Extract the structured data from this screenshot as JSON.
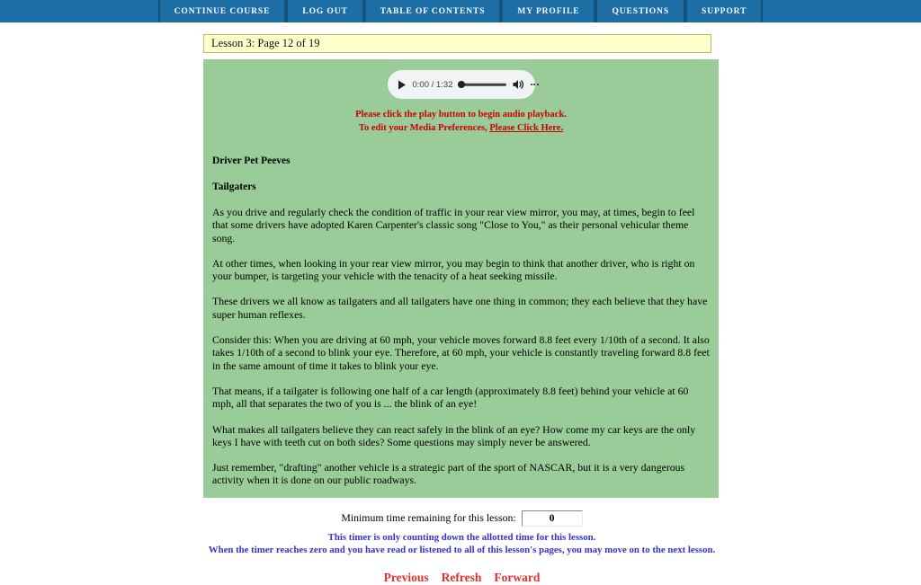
{
  "navbar": {
    "items": [
      {
        "label": "CONTINUE COURSE",
        "name": "nav-continue-course"
      },
      {
        "label": "LOG OUT",
        "name": "nav-log-out"
      },
      {
        "label": "TABLE OF CONTENTS",
        "name": "nav-table-of-contents"
      },
      {
        "label": "MY PROFILE",
        "name": "nav-my-profile"
      },
      {
        "label": "QUESTIONS",
        "name": "nav-questions"
      },
      {
        "label": "SUPPORT",
        "name": "nav-support"
      }
    ],
    "background_color": "#1d6ea4",
    "divider_color": "#14537c"
  },
  "lesson_header": {
    "text": "Lesson 3: Page 12 of 19",
    "background_color": "#ffffcc",
    "border_color": "#bdb76b"
  },
  "panel": {
    "background_color": "#99cc99"
  },
  "player": {
    "play_icon": "play-icon",
    "time": "0:00 / 1:32",
    "current_time": "0:00",
    "duration": "1:32",
    "progress_percent": 0,
    "volume_icon": "volume-icon",
    "menu_icon": "kebab-menu-icon"
  },
  "notices": {
    "line1": "Please click the play button to begin audio playback.",
    "line2_prefix": "To edit your Media Preferences, ",
    "line2_link": "Please Click Here.",
    "color": "#cc0000"
  },
  "lesson": {
    "title": "Driver Pet Peeves",
    "subtitle": "Tailgaters",
    "paragraphs": [
      "As you drive and regularly check the condition of traffic in your rear view mirror, you may, at times, begin to feel that some drivers have adopted Karen Carpenter's classic song \"Close to You,\" as their personal vehicular theme song.",
      "At other times, when looking in your rear view mirror, you may begin to think that another driver, who is right on your bumper, is targeting your vehicle with the tenacity of a heat seeking missile.",
      "These drivers we all know as tailgaters and all tailgaters have one thing in common; they each believe that they have super human reflexes.",
      "Consider this: When you are driving at 60 mph, your vehicle moves forward 8.8 feet every 1/10th of a second. It also takes 1/10th of a second to blink your eye. Therefore, at 60 mph, your vehicle is constantly traveling forward 8.8 feet in the same amount of time it takes to blink your eye.",
      "That means, if a tailgater is following one half of a car length (approximately 8.8 feet) behind your vehicle at 60 mph, all that separates the two of you is ... the blink of an eye!",
      "What makes all tailgaters believe they can react safely in the blink of an eye? How come my car keys are the only keys I have with teeth cut on both sides? Some questions may simply never be answered.",
      "Just remember, \"drafting\" another vehicle is a strategic part of the sport of NASCAR, but it is a very dangerous activity when it is done on our public roadways."
    ]
  },
  "timer": {
    "label": "Minimum time remaining for this lesson:",
    "value": "0",
    "note_line1": "This timer is only counting down the allotted time for this lesson.",
    "note_line2": "When the timer reaches zero and you have read or listened to all of this lesson's pages, you may move on to the next lesson.",
    "note_color": "#3333cc"
  },
  "bottom_nav": {
    "previous": "Previous",
    "refresh": "Refresh",
    "forward": "Forward",
    "color": "#e03030"
  }
}
